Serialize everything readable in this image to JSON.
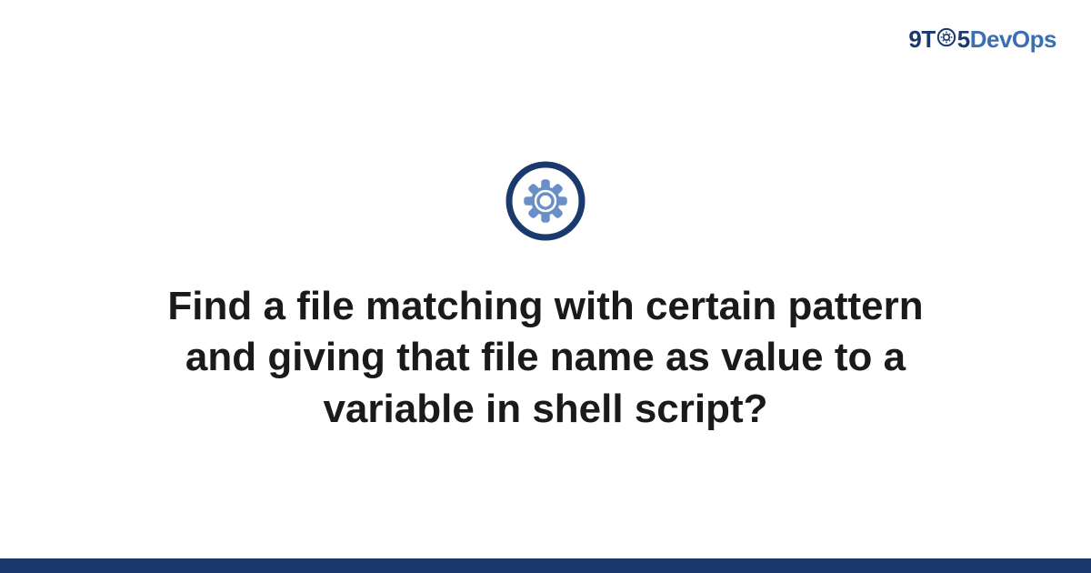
{
  "logo": {
    "prefix": "9T",
    "suffix": "5",
    "brand": "DevOps"
  },
  "title": "Find a file matching with certain pattern and giving that file name as value to a variable in shell script?",
  "colors": {
    "primary": "#1a3a6e",
    "accent": "#3a6fb5"
  }
}
